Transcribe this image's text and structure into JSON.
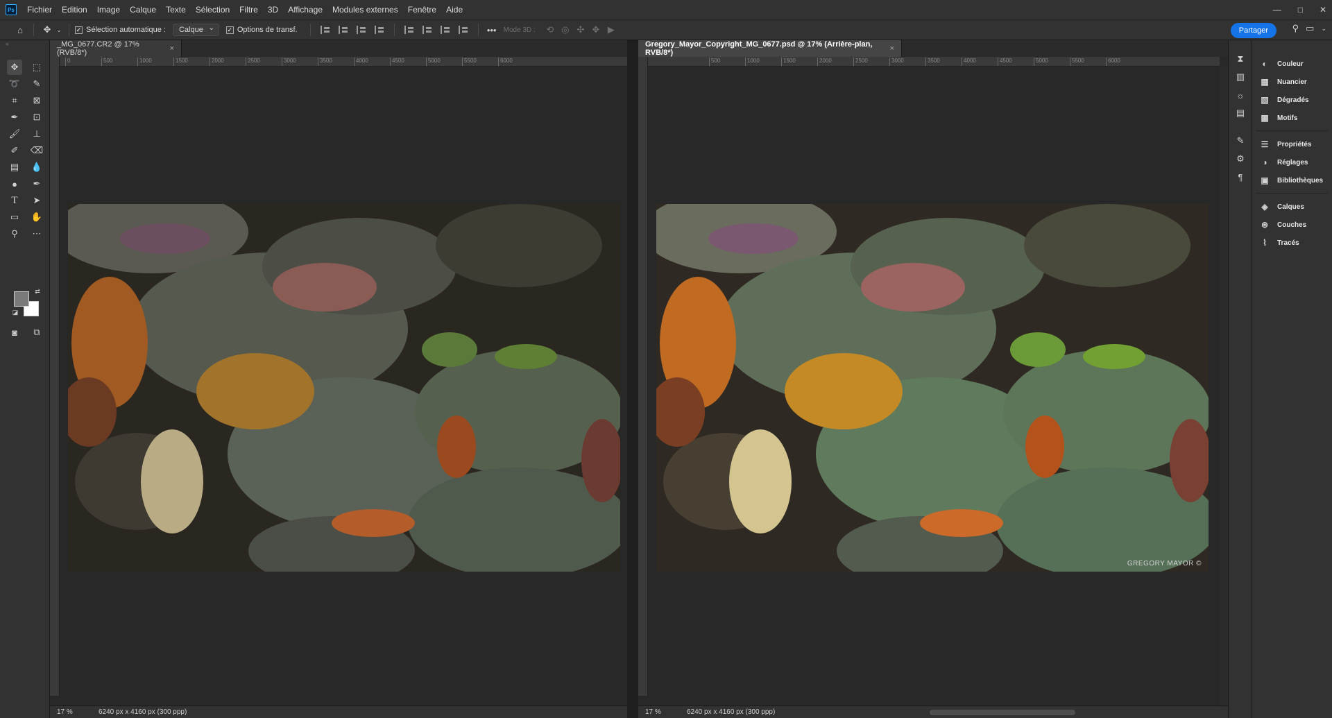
{
  "app": {
    "logo": "Ps"
  },
  "menu": [
    "Fichier",
    "Edition",
    "Image",
    "Calque",
    "Texte",
    "Sélection",
    "Filtre",
    "3D",
    "Affichage",
    "Modules externes",
    "Fenêtre",
    "Aide"
  ],
  "window_controls": {
    "minimize": "—",
    "maximize": "□",
    "close": "✕"
  },
  "options": {
    "auto_select_label": "Sélection automatique :",
    "auto_select_value": "Calque",
    "transform_label": "Options de transf.",
    "more": "•••",
    "mode3d_label": "Mode 3D :",
    "share_label": "Partager"
  },
  "documents": [
    {
      "tab": "_MG_0677.CR2 @ 17% (RVB/8*)",
      "close": "×",
      "zoom": "17 %",
      "info": "6240 px x 4160 px (300 ppp)",
      "ruler_h": [
        "0",
        "500",
        "1000",
        "1500",
        "2000",
        "2500",
        "3000",
        "3500",
        "4000",
        "4500",
        "5000",
        "5500",
        "6000"
      ],
      "watermark": ""
    },
    {
      "tab": "Gregory_Mayor_Copyright_MG_0677.psd @ 17% (Arrière-plan, RVB/8*)",
      "close": "×",
      "zoom": "17 %",
      "info": "6240 px x 4160 px (300 ppp)",
      "ruler_h": [
        "500",
        "1000",
        "1500",
        "2000",
        "2500",
        "3000",
        "3500",
        "4000",
        "4500",
        "5000",
        "5500",
        "6000"
      ],
      "watermark": "GREGORY MAYOR ©"
    }
  ],
  "panels": {
    "group1": [
      "Couleur",
      "Nuancier",
      "Dégradés",
      "Motifs"
    ],
    "group2": [
      "Propriétés",
      "Réglages",
      "Bibliothèques"
    ],
    "group3": [
      "Calques",
      "Couches",
      "Tracés"
    ]
  },
  "colors": {
    "foreground": "#7a7a7a",
    "background": "#ffffff",
    "accent": "#1473e6"
  }
}
